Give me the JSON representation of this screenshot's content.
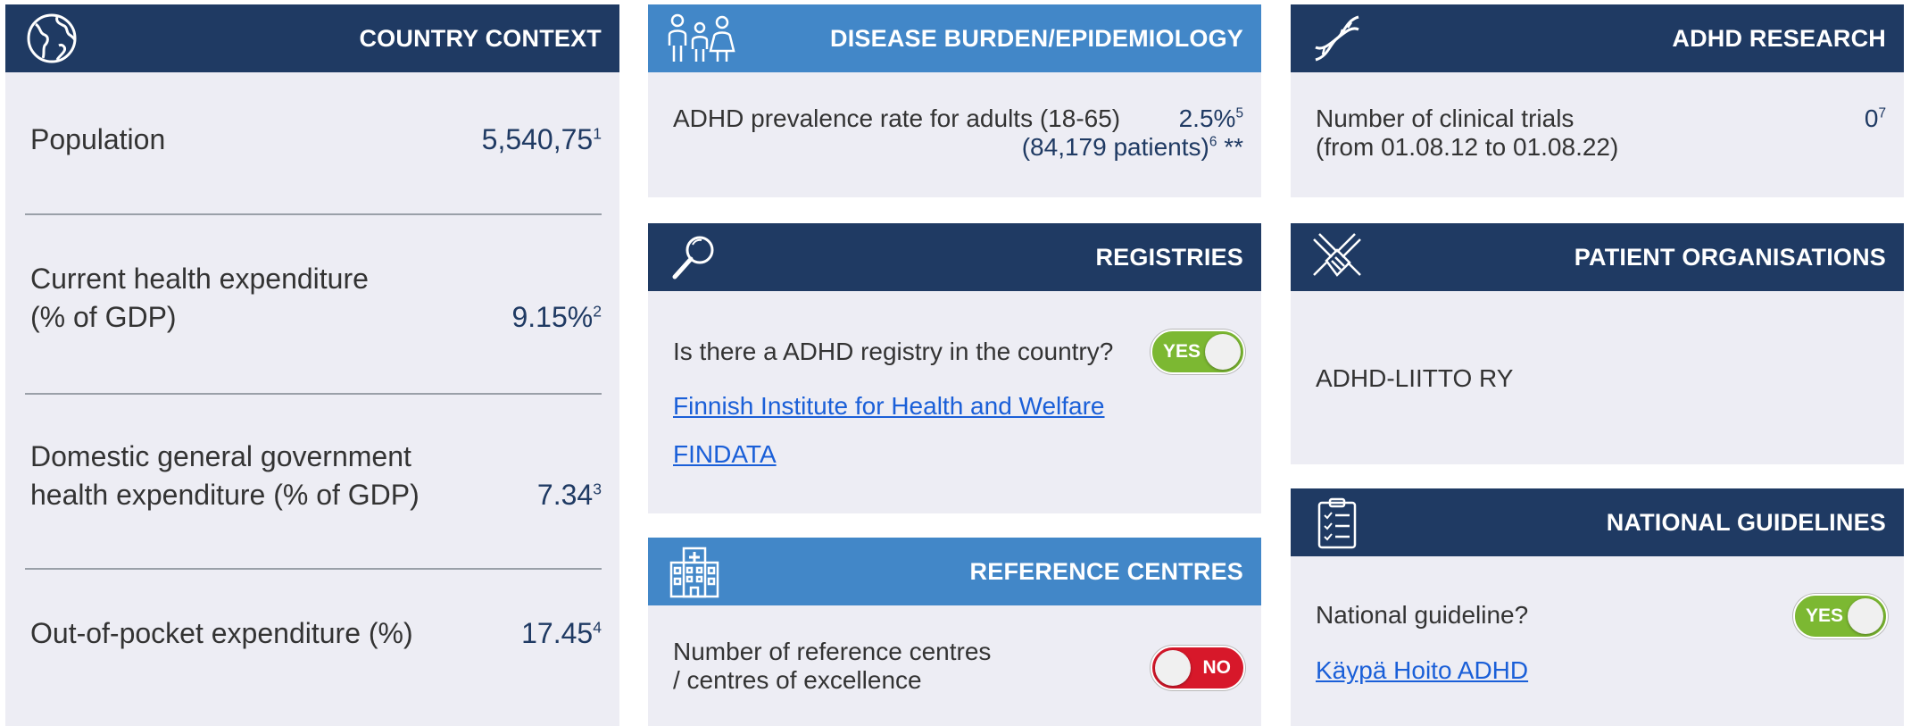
{
  "country_context": {
    "title": "COUNTRY CONTEXT",
    "icon": "globe-icon",
    "population_label": "Population",
    "population_value": "5,540,75",
    "population_ref": "1",
    "health_exp_line1": "Current health expenditure",
    "health_exp_line2": "(% of GDP)",
    "health_exp_value": "9.15%",
    "health_exp_ref": "2",
    "gov_exp_line1": "Domestic general government",
    "gov_exp_line2": "health expenditure (% of GDP)",
    "gov_exp_value": "7.34",
    "gov_exp_ref": "3",
    "oop_label": "Out-of-pocket expenditure (%)",
    "oop_value": "17.45",
    "oop_ref": "4"
  },
  "disease_burden": {
    "title": "DISEASE BURDEN/EPIDEMIOLOGY",
    "icon": "family-icon",
    "prevalence_label": "ADHD prevalence rate for adults (18-65)",
    "prevalence_value": "2.5%",
    "prevalence_ref": "5",
    "patients_value": "(84,179 patients)",
    "patients_ref": "6",
    "patients_note": " **"
  },
  "registries": {
    "title": "REGISTRIES",
    "icon": "magnifier-icon",
    "question": "Is there a ADHD registry in the country?",
    "toggle_label": "YES",
    "link1": "Finnish Institute for Health and Welfare",
    "link2": "FINDATA"
  },
  "reference_centres": {
    "title": "REFERENCE CENTRES",
    "icon": "hospital-icon",
    "label_line1": "Number of reference centres",
    "label_line2": "/ centres of excellence",
    "toggle_label": "NO"
  },
  "adhd_research": {
    "title": "ADHD RESEARCH",
    "icon": "dna-icon",
    "label_line1": "Number of clinical trials",
    "label_line2": "(from 01.08.12 to 01.08.22)",
    "value": "0",
    "ref": "7"
  },
  "patient_organisations": {
    "title": "PATIENT ORGANISATIONS",
    "icon": "handshake-icon",
    "org_name": "ADHD-LIITTO RY"
  },
  "national_guidelines": {
    "title": "NATIONAL GUIDELINES",
    "icon": "clipboard-checklist-icon",
    "question": "National guideline?",
    "toggle_label": "YES",
    "link": "Käypä Hoito ADHD"
  },
  "colors": {
    "dark_header": "#1f3a63",
    "light_header": "#4287c8",
    "panel_bg": "#ededf4",
    "toggle_yes": "#7cb832",
    "toggle_no": "#d7182a",
    "link": "#1a5fd8"
  }
}
